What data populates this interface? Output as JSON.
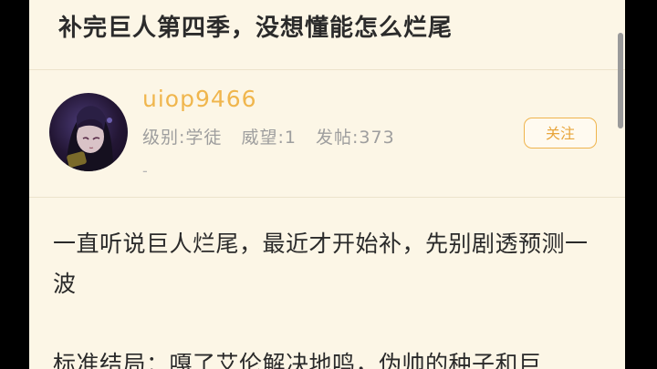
{
  "post": {
    "title": "补完巨人第四季，没想懂能怎么烂尾"
  },
  "author": {
    "username": "uiop9466",
    "level": "级别:学徒",
    "reputation": "威望:1",
    "posts": "发帖:373",
    "signature": "-",
    "follow_label": "关注"
  },
  "content": {
    "paragraphs": [
      "一直听说巨人烂尾，最近才开始补，先别剧透预测一波",
      "标准结局：嘎了艾伦解决地鸣，伪帅的种子和巨"
    ]
  },
  "colors": {
    "background": "#fcf6e6",
    "accent": "#f0b64d",
    "title_text": "#2b2b2b",
    "meta_text": "#9e9e9e"
  }
}
